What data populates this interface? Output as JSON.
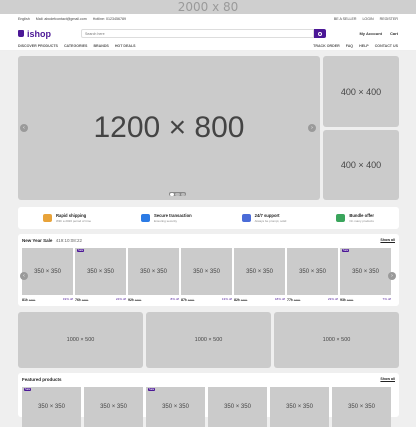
{
  "top_banner": "2000 x 80",
  "topbar": {
    "language": "English",
    "email": "Mail: abcdefcontact@gmail.com",
    "phone": "Hotline: 0123456789",
    "sell": "BE A SELLER",
    "login": "LOGIN",
    "register": "REGISTER"
  },
  "header": {
    "logo": "ishop",
    "search_placeholder": "Search here",
    "account": "My Account",
    "cart": "Cart"
  },
  "nav": {
    "left": [
      "DISCOVER PRODUCTS",
      "CATEGORIES",
      "BRANDS",
      "HOT DEALS"
    ],
    "right": [
      "TRACK ORDER",
      "FAQ",
      "HELP",
      "CONTACT US"
    ]
  },
  "hero": {
    "main": "1200 × 800",
    "side1": "400 × 400",
    "side2": "400 × 400"
  },
  "features": [
    {
      "title": "Rapid shipping",
      "sub": "With a 2020 period of time",
      "color": "#e8a33a"
    },
    {
      "title": "Secure transaction",
      "sub": "Ensuring security",
      "color": "#2c7be5"
    },
    {
      "title": "24/7 support",
      "sub": "Always be prompt, solid",
      "color": "#4b6cd8"
    },
    {
      "title": "Bundle offer",
      "sub": "On many products",
      "color": "#3aa55c"
    }
  ],
  "sale": {
    "title": "New Year Sale",
    "countdown": "419:10:08:22",
    "show_all": "Show all",
    "products": [
      {
        "img": "350 × 350",
        "badge": "",
        "price": "81৳",
        "old": "100৳",
        "off": "19% off"
      },
      {
        "img": "350 × 350",
        "badge": "Sale",
        "price": "76৳",
        "old": "100৳",
        "off": "24% off"
      },
      {
        "img": "350 × 350",
        "badge": "",
        "price": "92৳",
        "old": "100৳",
        "off": "8% off"
      },
      {
        "img": "350 × 350",
        "badge": "",
        "price": "87৳",
        "old": "100৳",
        "off": "13% off"
      },
      {
        "img": "350 × 350",
        "badge": "",
        "price": "82৳",
        "old": "100৳",
        "off": "18% off"
      },
      {
        "img": "350 × 350",
        "badge": "",
        "price": "77৳",
        "old": "100৳",
        "off": "23% off"
      },
      {
        "img": "350 × 350",
        "badge": "Sale",
        "price": "93৳",
        "old": "100৳",
        "off": "7% off"
      }
    ]
  },
  "banners": [
    "1000 × 500",
    "1000 × 500",
    "1000 × 500"
  ],
  "featured": {
    "title": "Featured products",
    "show_all": "Show all",
    "products": [
      {
        "img": "350 × 350",
        "badge": "Sale"
      },
      {
        "img": "350 × 350",
        "badge": ""
      },
      {
        "img": "350 × 350",
        "badge": "Sale"
      },
      {
        "img": "350 × 350",
        "badge": ""
      },
      {
        "img": "350 × 350",
        "badge": ""
      },
      {
        "img": "350 × 350",
        "badge": ""
      }
    ]
  }
}
